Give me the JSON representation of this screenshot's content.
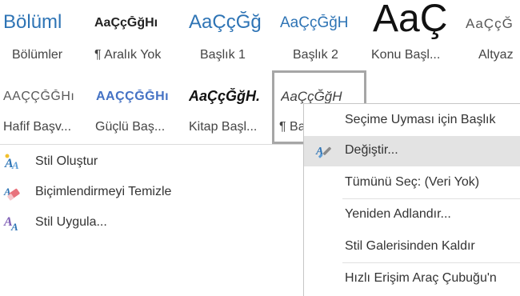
{
  "gallery": {
    "row1": [
      {
        "preview": "Bölüml",
        "caption": "Bölümler"
      },
      {
        "preview": "AaÇçĞğHı",
        "caption": "¶ Aralık Yok"
      },
      {
        "preview": "AaÇçĞğ",
        "caption": "Başlık 1"
      },
      {
        "preview": "AaÇçĞğH",
        "caption": "Başlık 2"
      },
      {
        "preview": "AaÇ",
        "caption": "Konu Başl..."
      },
      {
        "preview": "AaÇçĞ",
        "caption": "Altyaz"
      }
    ],
    "row2": [
      {
        "preview": "AAÇÇĞĞHı",
        "caption": "Hafif Başv..."
      },
      {
        "preview": "AAÇÇĞĞHı",
        "caption": "Güçlü Baş..."
      },
      {
        "preview": "AaÇçĞğH.",
        "caption": "Kitap Başl..."
      },
      {
        "preview": "AaÇçĞğH",
        "caption": "¶ Ba"
      }
    ]
  },
  "commands": [
    {
      "icon": "create-style-icon",
      "label": "Stil Oluştur"
    },
    {
      "icon": "clear-formatting-icon",
      "label": "Biçimlendirmeyi Temizle"
    },
    {
      "icon": "apply-style-icon",
      "label": "Stil Uygula..."
    }
  ],
  "context_menu": {
    "items": [
      {
        "label": "Seçime Uyması için Başlık",
        "icon": null
      },
      {
        "label": "Değiştir...",
        "icon": "modify-style-icon",
        "hover": true
      },
      {
        "label": "Tümünü Seç: (Veri Yok)",
        "icon": null
      },
      {
        "label": "Yeniden Adlandır...",
        "icon": null
      },
      {
        "label": "Stil Galerisinden Kaldır",
        "icon": null
      },
      {
        "label": "Hızlı Erişim Araç Çubuğu'n",
        "icon": null
      }
    ]
  },
  "colors": {
    "heading_blue": "#2e74b5",
    "accent_blue": "#4472c4",
    "hover_bg": "#e3e3e3",
    "selected_border": "#a6a6a6"
  }
}
